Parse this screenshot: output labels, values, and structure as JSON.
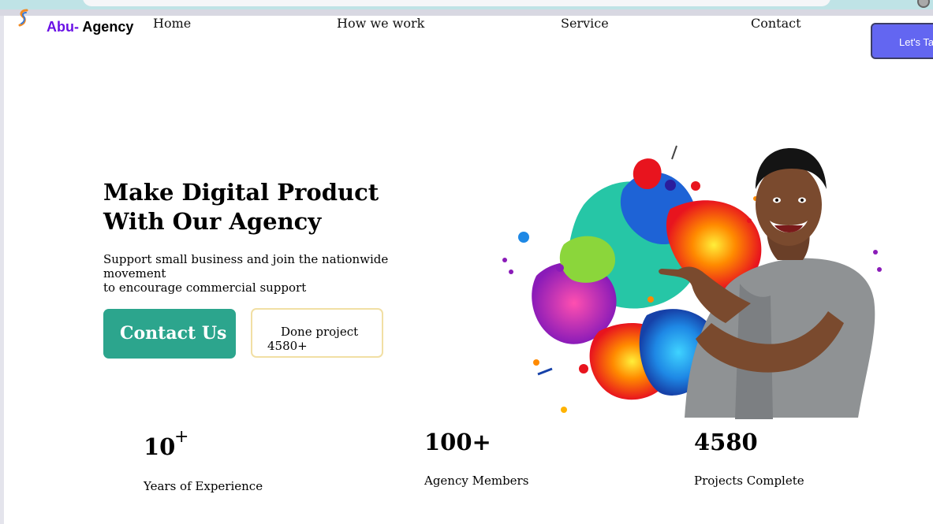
{
  "brand": {
    "accent": "Abu-",
    "name": " Agency",
    "accent_color": "#6a11e6"
  },
  "nav": {
    "home": "Home",
    "how": "How we work",
    "service": "Service",
    "contact": "Contact"
  },
  "cta": {
    "lets_talk": "Let's Talk",
    "color": "#6366f1"
  },
  "hero": {
    "title_line1": "Make Digital Product",
    "title_line2": "With Our Agency",
    "subtitle_line1": "Support small business and join the nationwide movement",
    "subtitle_line2": "to encourage commercial support",
    "contact_button": "Contact Us",
    "contact_color": "#2ca58d",
    "done_label": "Done project",
    "done_value": "4580+"
  },
  "stats": [
    {
      "value": "10",
      "suffix": "+",
      "label": "Years of Experience"
    },
    {
      "value": "100+",
      "label": "Agency Members"
    },
    {
      "value": "4580",
      "label": "Projects Complete"
    }
  ]
}
